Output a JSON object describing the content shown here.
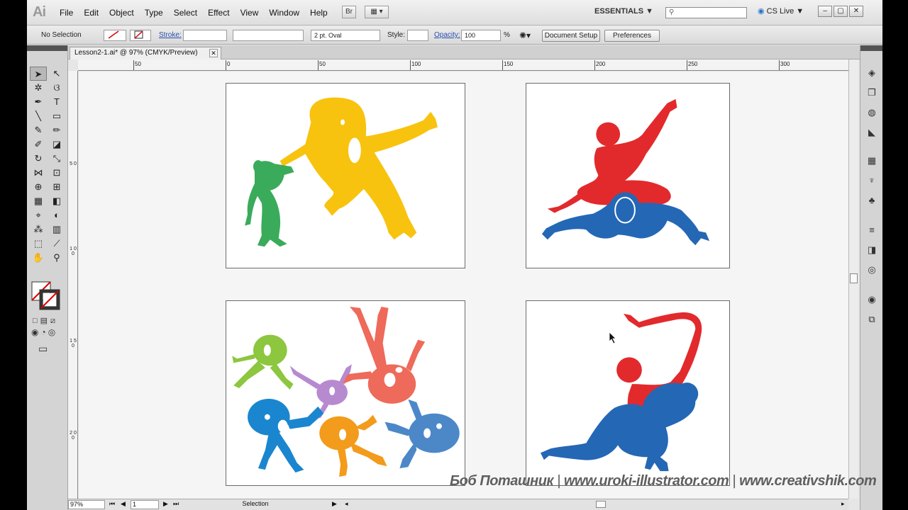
{
  "app": {
    "logo": "Ai"
  },
  "menu": [
    "File",
    "Edit",
    "Object",
    "Type",
    "Select",
    "Effect",
    "View",
    "Window",
    "Help"
  ],
  "toolbar": {
    "bridge": "Br",
    "arrange": "▦ ▾",
    "workspace": "ESSENTIALS ▼",
    "search_placeholder": "",
    "cslive": "CS Live ▼"
  },
  "window": {
    "minimize": "–",
    "restore": "▢",
    "close": "✕"
  },
  "control": {
    "selection": "No Selection",
    "stroke_label": "Stroke:",
    "brush": "2 pt. Oval",
    "style_label": "Style:",
    "opacity_label": "Opacity:",
    "opacity_value": "100",
    "opacity_unit": "%",
    "doc_setup": "Document Setup",
    "preferences": "Preferences"
  },
  "document": {
    "tab_title": "Lesson2-1.ai* @ 97% (CMYK/Preview)",
    "close": "✕"
  },
  "ruler": {
    "top_labels": [
      "50",
      "0",
      "50",
      "100",
      "150",
      "200",
      "250",
      "300"
    ],
    "left_labels": [
      "5 0",
      "1 0 0",
      "1 5 0",
      "2 0 0"
    ]
  },
  "status": {
    "zoom": "97%",
    "page": "1",
    "mode": "Selection"
  },
  "watermark": {
    "author": "Боб Поташник",
    "site1": "www.uroki-illustrator.com",
    "site2": "www.creativshik.com",
    "sep": "|"
  },
  "colors": {
    "yellow": "#f8c30f",
    "green": "#3aab5a",
    "red": "#e22a2d",
    "blue": "#2467b5",
    "lime": "#8dc63f",
    "violet": "#b78ad0",
    "salmon": "#ee6a5a",
    "cyan": "#1a86cf",
    "orange": "#f39b1b",
    "steel": "#4c88c8"
  }
}
